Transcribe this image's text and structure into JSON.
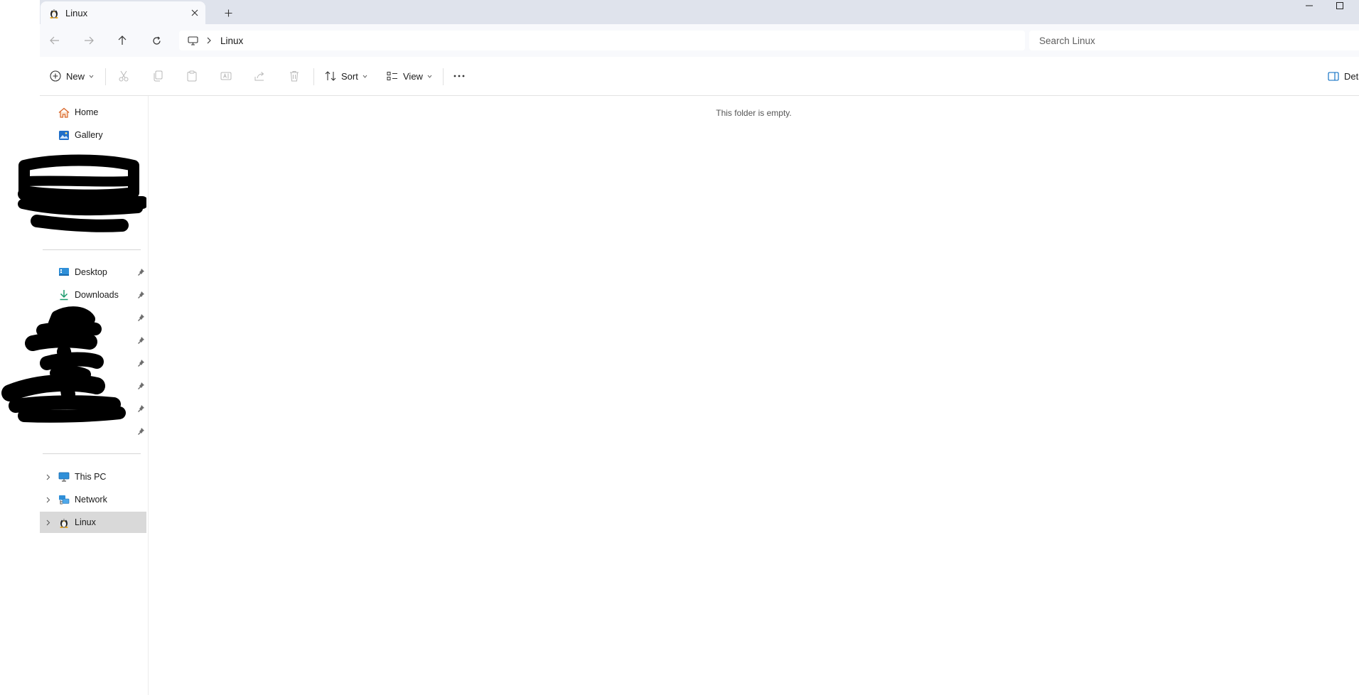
{
  "tab": {
    "title": "Linux",
    "new_tab_glyph": "+"
  },
  "address": {
    "crumb": "Linux"
  },
  "search": {
    "placeholder": "Search Linux"
  },
  "toolbar": {
    "new_label": "New",
    "sort_label": "Sort",
    "view_label": "View",
    "details_label": "Details"
  },
  "sidebar": {
    "home": "Home",
    "gallery": "Gallery",
    "desktop": "Desktop",
    "downloads": "Downloads",
    "this_pc": "This PC",
    "network": "Network",
    "linux": "Linux"
  },
  "content": {
    "empty_message": "This folder is empty."
  },
  "colors": {
    "accent": "#0067c0",
    "titlebar": "#dfe3ec",
    "selected": "#d9d9d9"
  },
  "icons": [
    "linux-tux-icon",
    "close-icon",
    "plus-icon",
    "minimize-icon",
    "maximize-icon",
    "back-arrow-icon",
    "forward-arrow-icon",
    "up-arrow-icon",
    "refresh-icon",
    "pc-icon",
    "chevron-right-icon",
    "new-icon",
    "cut-icon",
    "copy-icon",
    "paste-icon",
    "rename-icon",
    "share-icon",
    "delete-icon",
    "sort-icon",
    "view-icon",
    "more-icon",
    "details-pane-icon",
    "home-icon",
    "gallery-icon",
    "desktop-icon",
    "downloads-icon",
    "pin-icon",
    "this-pc-icon",
    "network-icon"
  ]
}
